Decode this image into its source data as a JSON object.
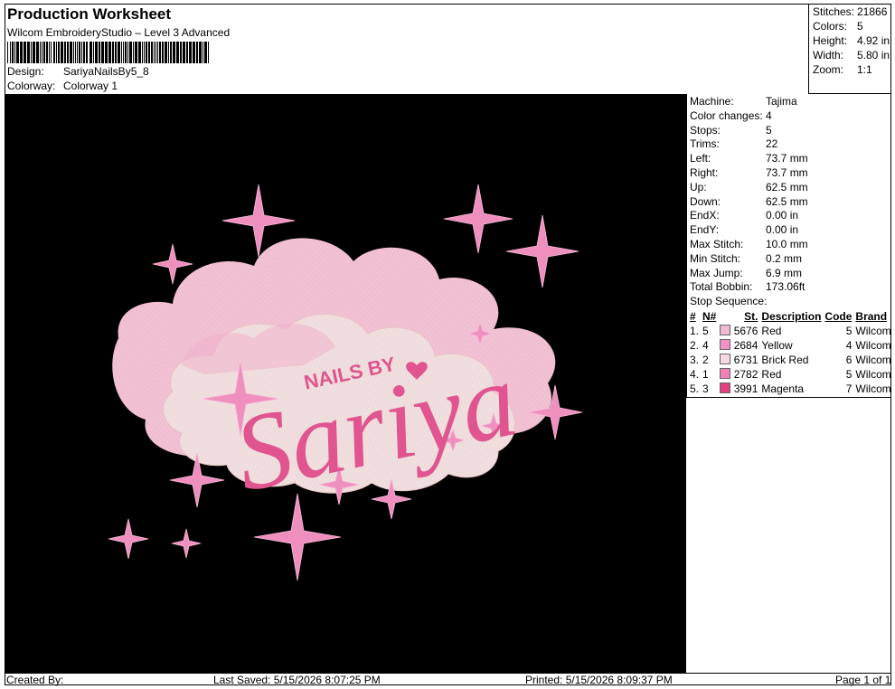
{
  "header": {
    "title": "Production Worksheet",
    "software": "Wilcom EmbroideryStudio – Level 3 Advanced",
    "design_label": "Design:",
    "design_value": "SariyaNailsBy5_8",
    "colorway_label": "Colorway:",
    "colorway_value": "Colorway 1"
  },
  "stats": [
    {
      "label": "Stitches:",
      "value": "21866"
    },
    {
      "label": "Colors:",
      "value": "5"
    },
    {
      "label": "Height:",
      "value": "4.92 in"
    },
    {
      "label": "Width:",
      "value": "5.80 in"
    },
    {
      "label": "Zoom:",
      "value": "1:1"
    }
  ],
  "machine": [
    {
      "label": "Machine:",
      "value": "Tajima"
    },
    {
      "label": "Color changes:",
      "value": "4"
    },
    {
      "label": "Stops:",
      "value": "5"
    },
    {
      "label": "Trims:",
      "value": "22"
    },
    {
      "label": "Left:",
      "value": "73.7 mm"
    },
    {
      "label": "Right:",
      "value": "73.7 mm"
    },
    {
      "label": "Up:",
      "value": "62.5 mm"
    },
    {
      "label": "Down:",
      "value": "62.5 mm"
    },
    {
      "label": "EndX:",
      "value": "0.00 in"
    },
    {
      "label": "EndY:",
      "value": "0.00 in"
    },
    {
      "label": "Max Stitch:",
      "value": "10.0 mm"
    },
    {
      "label": "Min Stitch:",
      "value": "0.2 mm"
    },
    {
      "label": "Max Jump:",
      "value": "6.9 mm"
    },
    {
      "label": "Total Bobbin:",
      "value": "173.06ft"
    }
  ],
  "stop_sequence": {
    "label": "Stop Sequence:",
    "headers": [
      "#",
      "N#",
      "St.",
      "Description",
      "Code",
      "Brand"
    ],
    "rows": [
      {
        "num": "1.",
        "n": "5",
        "color": "#f0b9d3",
        "st": "5676",
        "desc": "Red",
        "code": "5",
        "brand": "Wilcom"
      },
      {
        "num": "2.",
        "n": "4",
        "color": "#f291c4",
        "st": "2684",
        "desc": "Yellow",
        "code": "4",
        "brand": "Wilcom"
      },
      {
        "num": "3.",
        "n": "2",
        "color": "#f6d7e3",
        "st": "6731",
        "desc": "Brick Red",
        "code": "6",
        "brand": "Wilcom"
      },
      {
        "num": "4.",
        "n": "1",
        "color": "#ee82b6",
        "st": "2782",
        "desc": "Red",
        "code": "5",
        "brand": "Wilcom"
      },
      {
        "num": "5.",
        "n": "3",
        "color": "#e2407f",
        "st": "3991",
        "desc": "Magenta",
        "code": "7",
        "brand": "Wilcom"
      }
    ]
  },
  "design": {
    "small_text": "NAILS BY",
    "script_text": "Sariya",
    "colors": {
      "cloud_back": "#f2c7d9",
      "cloud_front": "#f1dede",
      "star": "#ef8fbe",
      "script": "#e0558f"
    }
  },
  "footer": {
    "created": "Created By:",
    "saved": "Last Saved: 5/15/2026 8:07:25 PM",
    "printed": "Printed: 5/15/2026 8:09:37 PM",
    "page": "Page 1 of 1"
  }
}
